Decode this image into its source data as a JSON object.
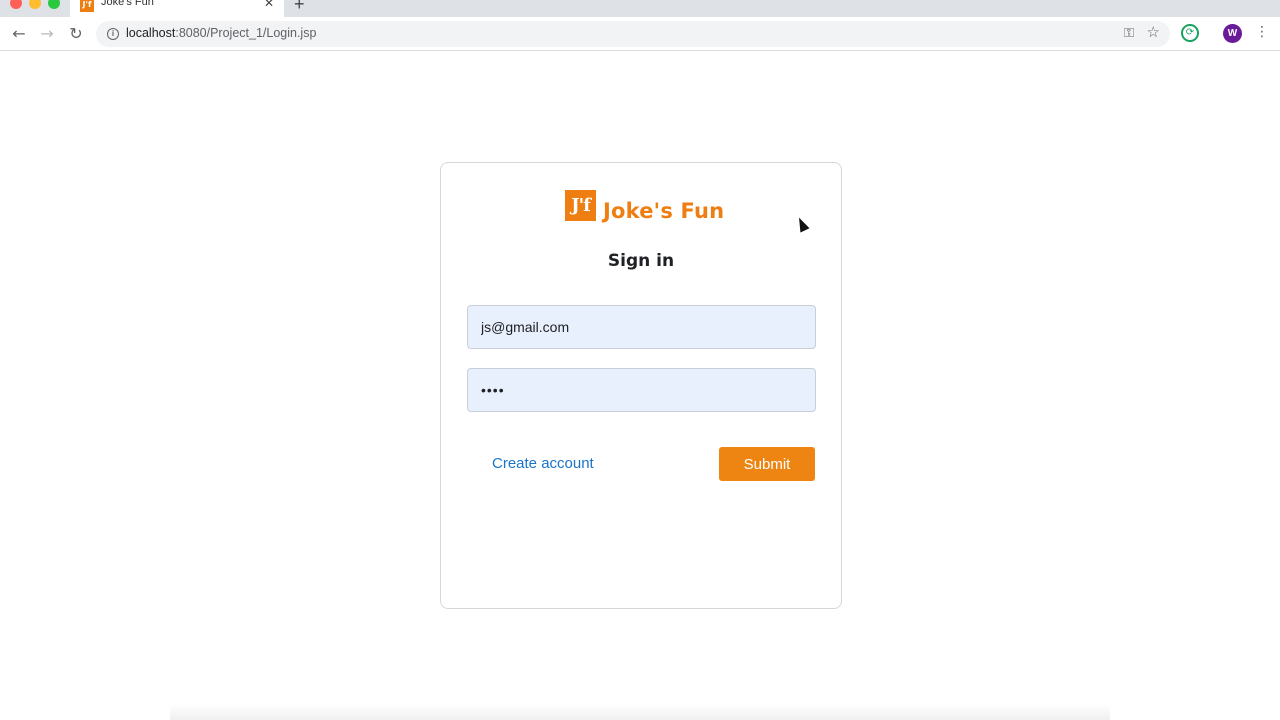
{
  "browser": {
    "tab_title": "Joke's Fun",
    "tab_favicon": "J'f",
    "url_host": "localhost",
    "url_rest": ":8080/Project_1/Login.jsp",
    "profile_initial": "W"
  },
  "card": {
    "logo_text": "J'f",
    "brand_name": "Joke's Fun",
    "heading": "Sign in",
    "email_value": "js@gmail.com",
    "password_value": "••••",
    "create_account_label": "Create account",
    "submit_label": "Submit"
  },
  "colors": {
    "brand": "#ee7e12",
    "link": "#1a73c9",
    "field_bg": "#e8f0fe"
  },
  "icons": [
    "back-arrow-icon",
    "forward-arrow-icon",
    "reload-icon",
    "info-icon",
    "key-icon",
    "star-icon",
    "sync-icon",
    "menu-icon",
    "close-icon",
    "plus-icon"
  ]
}
